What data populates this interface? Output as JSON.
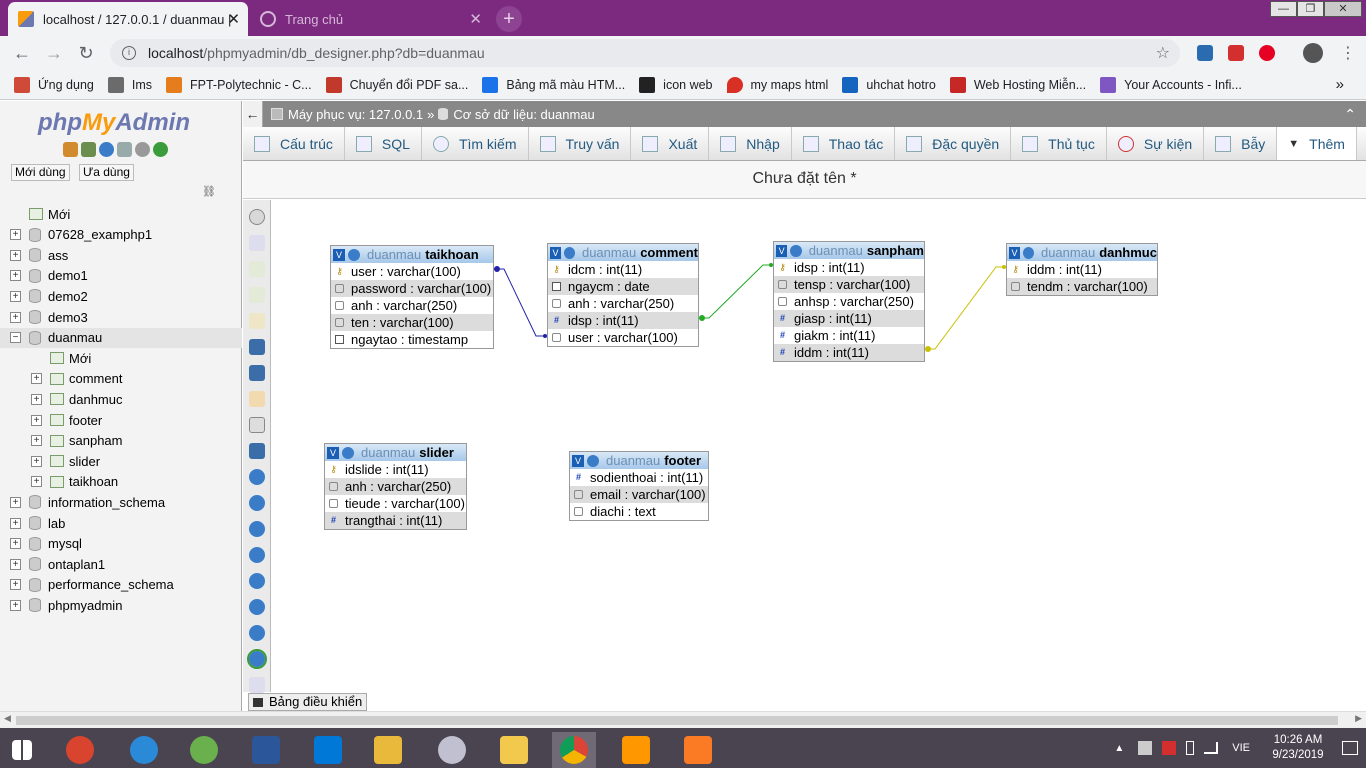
{
  "browser": {
    "tabs": [
      {
        "title": "localhost / 127.0.0.1 / duanmau |",
        "close": "✕",
        "active": true
      },
      {
        "title": "Trang chủ",
        "close": "✕",
        "active": false
      }
    ],
    "new_tab": "+",
    "window_buttons": {
      "minimize": "—",
      "restore": "❐",
      "close": "✕"
    },
    "nav": {
      "back": "←",
      "forward": "→",
      "reload": "↻"
    },
    "url_host": "localhost",
    "url_path": "/phpmyadmin/db_designer.php?db=duanmau",
    "bookmark_star": "☆",
    "bookmarks": [
      {
        "label": "Ứng dụng",
        "color": "#d04a3a"
      },
      {
        "label": "Ims",
        "color": "#6b6b6b"
      },
      {
        "label": "FPT-Polytechnic - C...",
        "color": "#e57c1e"
      },
      {
        "label": "Chuyển đổi PDF sa...",
        "color": "#c0392b"
      },
      {
        "label": "Bảng mã màu HTM...",
        "color": "#1a73e8"
      },
      {
        "label": "icon web",
        "color": "#222222"
      },
      {
        "label": "my maps html",
        "color": "#d93025"
      },
      {
        "label": "uhchat hotro",
        "color": "#1565c0"
      },
      {
        "label": "Web Hosting Miễn...",
        "color": "#c62828"
      },
      {
        "label": "Your Accounts - Infi...",
        "color": "#7e57c2"
      }
    ],
    "more_bookmarks": "»"
  },
  "sidebar": {
    "logo_php": "php",
    "logo_my": "My",
    "logo_admin": "Admin",
    "btn_recent": "Mới dùng",
    "btn_favorite": "Ưa dùng",
    "link_icon": "⛓",
    "tree": [
      {
        "label": "Mới",
        "kind": "new",
        "level": 0
      },
      {
        "label": "07628_examphp1",
        "kind": "db",
        "level": 0
      },
      {
        "label": "ass",
        "kind": "db",
        "level": 0
      },
      {
        "label": "demo1",
        "kind": "db",
        "level": 0
      },
      {
        "label": "demo2",
        "kind": "db",
        "level": 0
      },
      {
        "label": "demo3",
        "kind": "db",
        "level": 0
      },
      {
        "label": "duanmau",
        "kind": "db-open",
        "level": 0
      },
      {
        "label": "Mới",
        "kind": "new",
        "level": 1
      },
      {
        "label": "comment",
        "kind": "table",
        "level": 1
      },
      {
        "label": "danhmuc",
        "kind": "table",
        "level": 1
      },
      {
        "label": "footer",
        "kind": "table",
        "level": 1
      },
      {
        "label": "sanpham",
        "kind": "table",
        "level": 1
      },
      {
        "label": "slider",
        "kind": "table",
        "level": 1
      },
      {
        "label": "taikhoan",
        "kind": "table",
        "level": 1
      },
      {
        "label": "information_schema",
        "kind": "db",
        "level": 0
      },
      {
        "label": "lab",
        "kind": "db",
        "level": 0
      },
      {
        "label": "mysql",
        "kind": "db",
        "level": 0
      },
      {
        "label": "ontaplan1",
        "kind": "db",
        "level": 0
      },
      {
        "label": "performance_schema",
        "kind": "db",
        "level": 0
      },
      {
        "label": "phpmyadmin",
        "kind": "db",
        "level": 0
      }
    ]
  },
  "breadcrumb": {
    "server": "Máy phục vụ: 127.0.0.1",
    "sep": "»",
    "database": "Cơ sở dữ liệu: duanmau",
    "collapse": "⌃"
  },
  "tabs": [
    {
      "label": "Cấu trúc"
    },
    {
      "label": "SQL"
    },
    {
      "label": "Tìm kiếm"
    },
    {
      "label": "Truy vấn"
    },
    {
      "label": "Xuất"
    },
    {
      "label": "Nhập"
    },
    {
      "label": "Thao tác"
    },
    {
      "label": "Đặc quyền"
    },
    {
      "label": "Thủ tục"
    },
    {
      "label": "Sự kiện"
    },
    {
      "label": "Bẫy"
    },
    {
      "label": "Thêm"
    }
  ],
  "designer": {
    "title": "Chưa đặt tên *",
    "db_name": "duanmau",
    "tables": [
      {
        "name": "taikhoan",
        "columns": [
          {
            "text": "user : varchar(100)",
            "icon": "key"
          },
          {
            "text": "password : varchar(100)",
            "icon": "txt"
          },
          {
            "text": "anh : varchar(250)",
            "icon": "txt"
          },
          {
            "text": "ten : varchar(100)",
            "icon": "txt"
          },
          {
            "text": "ngaytao : timestamp",
            "icon": "date"
          }
        ]
      },
      {
        "name": "comment",
        "columns": [
          {
            "text": "idcm : int(11)",
            "icon": "key"
          },
          {
            "text": "ngaycm : date",
            "icon": "date"
          },
          {
            "text": "anh : varchar(250)",
            "icon": "txt"
          },
          {
            "text": "idsp : int(11)",
            "icon": "num"
          },
          {
            "text": "user : varchar(100)",
            "icon": "txt"
          }
        ]
      },
      {
        "name": "sanpham",
        "columns": [
          {
            "text": "idsp : int(11)",
            "icon": "key"
          },
          {
            "text": "tensp : varchar(100)",
            "icon": "txt"
          },
          {
            "text": "anhsp : varchar(250)",
            "icon": "txt"
          },
          {
            "text": "giasp : int(11)",
            "icon": "num"
          },
          {
            "text": "giakm : int(11)",
            "icon": "num"
          },
          {
            "text": "iddm : int(11)",
            "icon": "num"
          }
        ]
      },
      {
        "name": "danhmuc",
        "columns": [
          {
            "text": "iddm : int(11)",
            "icon": "key"
          },
          {
            "text": "tendm : varchar(100)",
            "icon": "txt"
          }
        ]
      },
      {
        "name": "slider",
        "columns": [
          {
            "text": "idslide : int(11)",
            "icon": "key"
          },
          {
            "text": "anh : varchar(250)",
            "icon": "txt"
          },
          {
            "text": "tieude : varchar(100)",
            "icon": "txt"
          },
          {
            "text": "trangthai : int(11)",
            "icon": "num"
          }
        ]
      },
      {
        "name": "footer",
        "columns": [
          {
            "text": "sodienthoai : int(11)",
            "icon": "num"
          },
          {
            "text": "email : varchar(100)",
            "icon": "txt"
          },
          {
            "text": "diachi : text",
            "icon": "txt"
          }
        ]
      }
    ],
    "relation_colors": {
      "taikhoan_comment": "#2222aa",
      "sanpham_comment": "#22aa22",
      "danhmuc_sanpham": "#c8c000"
    },
    "bottom_panel": "Bảng điều khiển"
  },
  "taskbar": {
    "language": "VIE",
    "time": "10:26 AM",
    "date": "9/23/2019",
    "tray_up": "▲"
  }
}
